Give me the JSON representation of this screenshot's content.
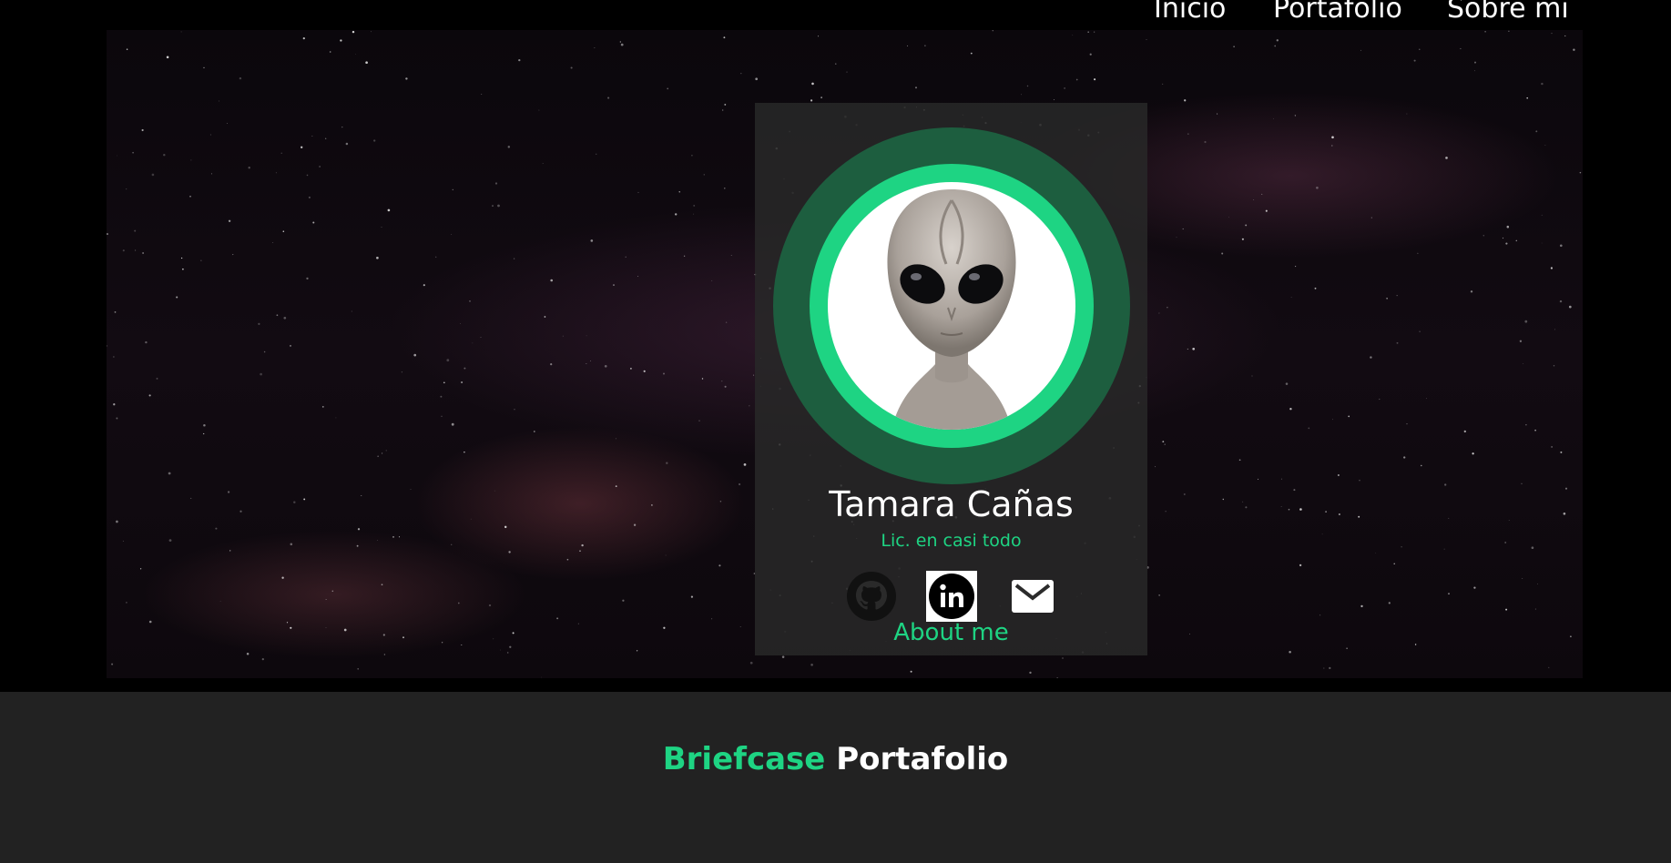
{
  "nav": {
    "items": [
      {
        "label": "Inicio"
      },
      {
        "label": "Portafolio"
      },
      {
        "label": "Sobre mi"
      }
    ]
  },
  "profile": {
    "name": "Tamara Cañas",
    "subtitle": "Lic. en casi todo",
    "avatar_icon": "alien-icon",
    "socials": [
      {
        "name": "github",
        "icon": "github-icon"
      },
      {
        "name": "linkedin",
        "icon": "linkedin-icon"
      },
      {
        "name": "email",
        "icon": "envelope-icon"
      }
    ],
    "about_label": "About me"
  },
  "section": {
    "icon_word": "Briefcase",
    "title": "Portafolio"
  },
  "colors": {
    "accent": "#1ed483",
    "ring_outer": "#1d5e3f",
    "card_bg": "#282828",
    "footer_bg": "#222222"
  }
}
